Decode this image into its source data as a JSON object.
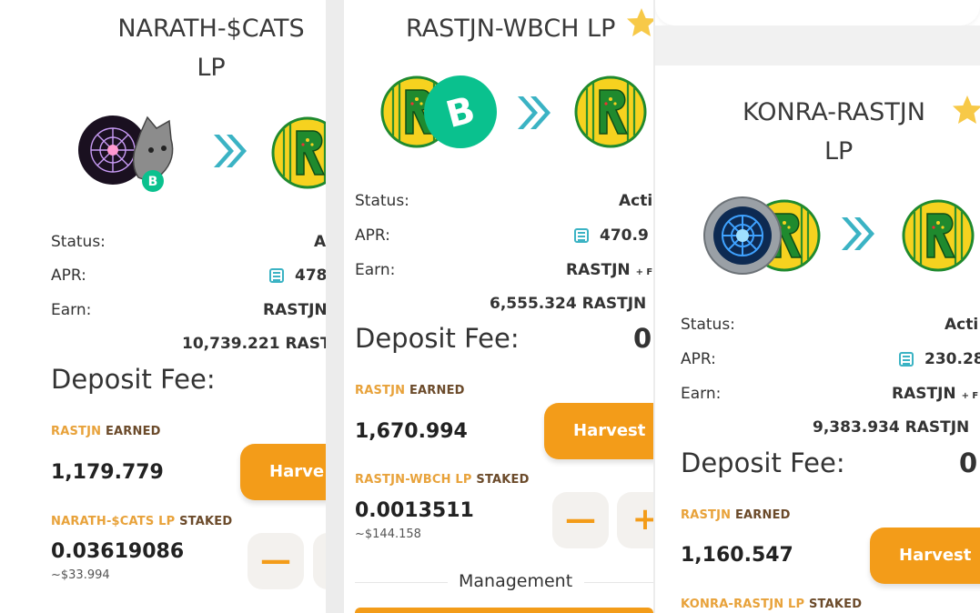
{
  "panels": [
    {
      "title_line1": "NARATH-$CATS",
      "title_line2": "LP",
      "status_label": "Status:",
      "status_value": "A",
      "apr_label": "APR:",
      "apr_value": "478",
      "earn_label": "Earn:",
      "earn_value": "RASTJN",
      "earn_amount": "10,739.221 RASTJ",
      "deposit_fee_label": "Deposit Fee:",
      "earned_token": "RASTJN",
      "earned_word": "EARNED",
      "earned_amount": "1,179.779",
      "harvest_label": "Harve",
      "staked_token": "NARATH-$CATS LP",
      "staked_word": "STAKED",
      "staked_amount": "0.03619086",
      "staked_usd": "~$33.994",
      "minus_label": "—"
    },
    {
      "title": "RASTJN-WBCH LP",
      "status_label": "Status:",
      "status_value": "Acti",
      "apr_label": "APR:",
      "apr_value": "470.9",
      "earn_label": "Earn:",
      "earn_value": "RASTJN",
      "earn_plus": "+ F",
      "earn_amount": "6,555.324 RASTJN",
      "deposit_fee_label": "Deposit Fee:",
      "deposit_fee_value": "0",
      "earned_token": "RASTJN",
      "earned_word": "EARNED",
      "earned_amount": "1,670.994",
      "harvest_label": "Harvest",
      "staked_token": "RASTJN-WBCH LP",
      "staked_word": "STAKED",
      "staked_amount": "0.0013511",
      "staked_usd": "~$144.158",
      "minus_label": "—",
      "plus_label": "+",
      "management_label": "Management"
    },
    {
      "title_line1": "KONRA-RASTJN",
      "title_line2": "LP",
      "status_label": "Status:",
      "status_value": "Acti",
      "apr_label": "APR:",
      "apr_value": "230.28",
      "earn_label": "Earn:",
      "earn_value": "RASTJN",
      "earn_plus": "+ F",
      "earn_amount": "9,383.934 RASTJN",
      "deposit_fee_label": "Deposit Fee:",
      "deposit_fee_value": "0",
      "earned_token": "RASTJN",
      "earned_word": "EARNED",
      "earned_amount": "1,160.547",
      "harvest_label": "Harvest",
      "staked_token": "KONRA-RASTJN LP",
      "staked_word": "STAKED"
    }
  ],
  "colors": {
    "accent": "#f39c19",
    "earned_highlight": "#e8a23a",
    "earned_dark": "#6b4a2a",
    "arrow": "#3bb3c4",
    "rastjn_coin": "#f6d21f",
    "rastjn_green": "#1f8a2e",
    "bch_green": "#0ac18e"
  },
  "icons": [
    "rastjn-token-icon",
    "bch-token-icon",
    "double-chevron-arrow-icon",
    "star-icon",
    "calculator-icon",
    "narath-token-icon",
    "cats-token-icon",
    "konra-token-icon"
  ]
}
